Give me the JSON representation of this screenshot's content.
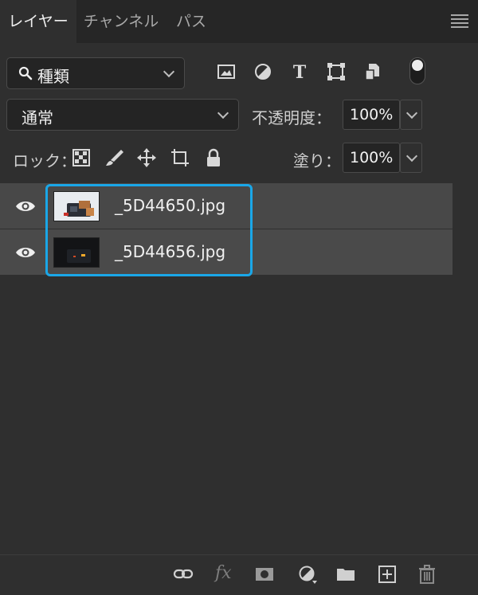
{
  "tabs": [
    {
      "label": "レイヤー",
      "active": true
    },
    {
      "label": "チャンネル",
      "active": false
    },
    {
      "label": "パス",
      "active": false
    }
  ],
  "filter": {
    "kind_label": "種類",
    "icons": [
      "image-filter-icon",
      "adjustment-filter-icon",
      "type-filter-icon",
      "shape-filter-icon",
      "smart-object-filter-icon"
    ],
    "toggle_on": true
  },
  "blend": {
    "mode": "通常",
    "opacity_label": "不透明度：",
    "opacity_value": "100%"
  },
  "lock": {
    "label": "ロック：",
    "icons": [
      "lock-transparent-pixels-icon",
      "lock-image-pixels-icon",
      "lock-position-icon",
      "lock-artboard-icon",
      "lock-all-icon"
    ],
    "fill_label": "塗り：",
    "fill_value": "100%"
  },
  "layers": [
    {
      "name": "_5D44650.jpg",
      "visible": true,
      "selected": true
    },
    {
      "name": "_5D44656.jpg",
      "visible": true,
      "selected": true
    }
  ],
  "colors": {
    "panel_bg": "#2f2f2f",
    "tabbar_bg": "#262626",
    "selection_outline": "#1aa7e8",
    "row_bg": "#484848"
  },
  "bottom_toolbar": {
    "fx_label": "fx",
    "icons": [
      "link-layers-icon",
      "fx-icon",
      "add-mask-icon",
      "new-adjustment-layer-icon",
      "new-group-icon",
      "new-layer-icon",
      "delete-layer-icon"
    ]
  }
}
